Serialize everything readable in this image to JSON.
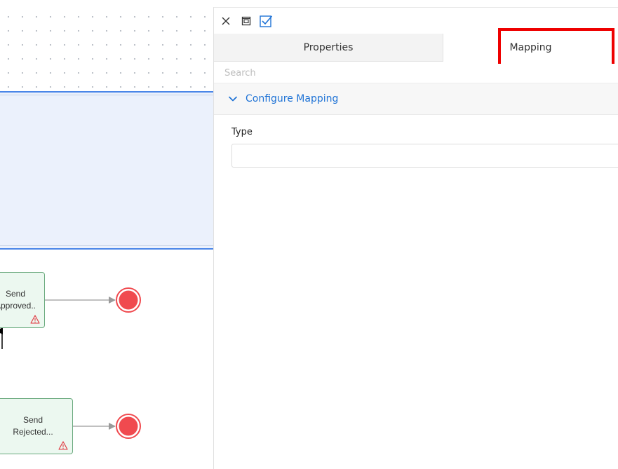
{
  "canvas": {
    "tasks": [
      {
        "id": "approved",
        "lines": [
          "Send",
          "Approved.."
        ]
      },
      {
        "id": "rejected",
        "lines": [
          "Send",
          "Rejected..."
        ]
      }
    ]
  },
  "panel": {
    "toolbar": {
      "close_icon": "close-icon",
      "window_icon": "window-icon",
      "check_icon": "checkbox-checked-icon"
    },
    "tabs": [
      {
        "label": "Properties",
        "active": false
      },
      {
        "label": "Mapping",
        "active": true
      }
    ],
    "search": {
      "placeholder": "Search",
      "value": ""
    },
    "section": {
      "title": "Configure Mapping",
      "expanded": true
    },
    "fields": [
      {
        "label": "Type",
        "value": ""
      }
    ]
  },
  "colors": {
    "accent": "#1f73d6",
    "highlight": "#ee0000",
    "task_fill": "#ecf8f0",
    "task_border": "#6aaa7e",
    "end_event": "#f04a4f"
  }
}
